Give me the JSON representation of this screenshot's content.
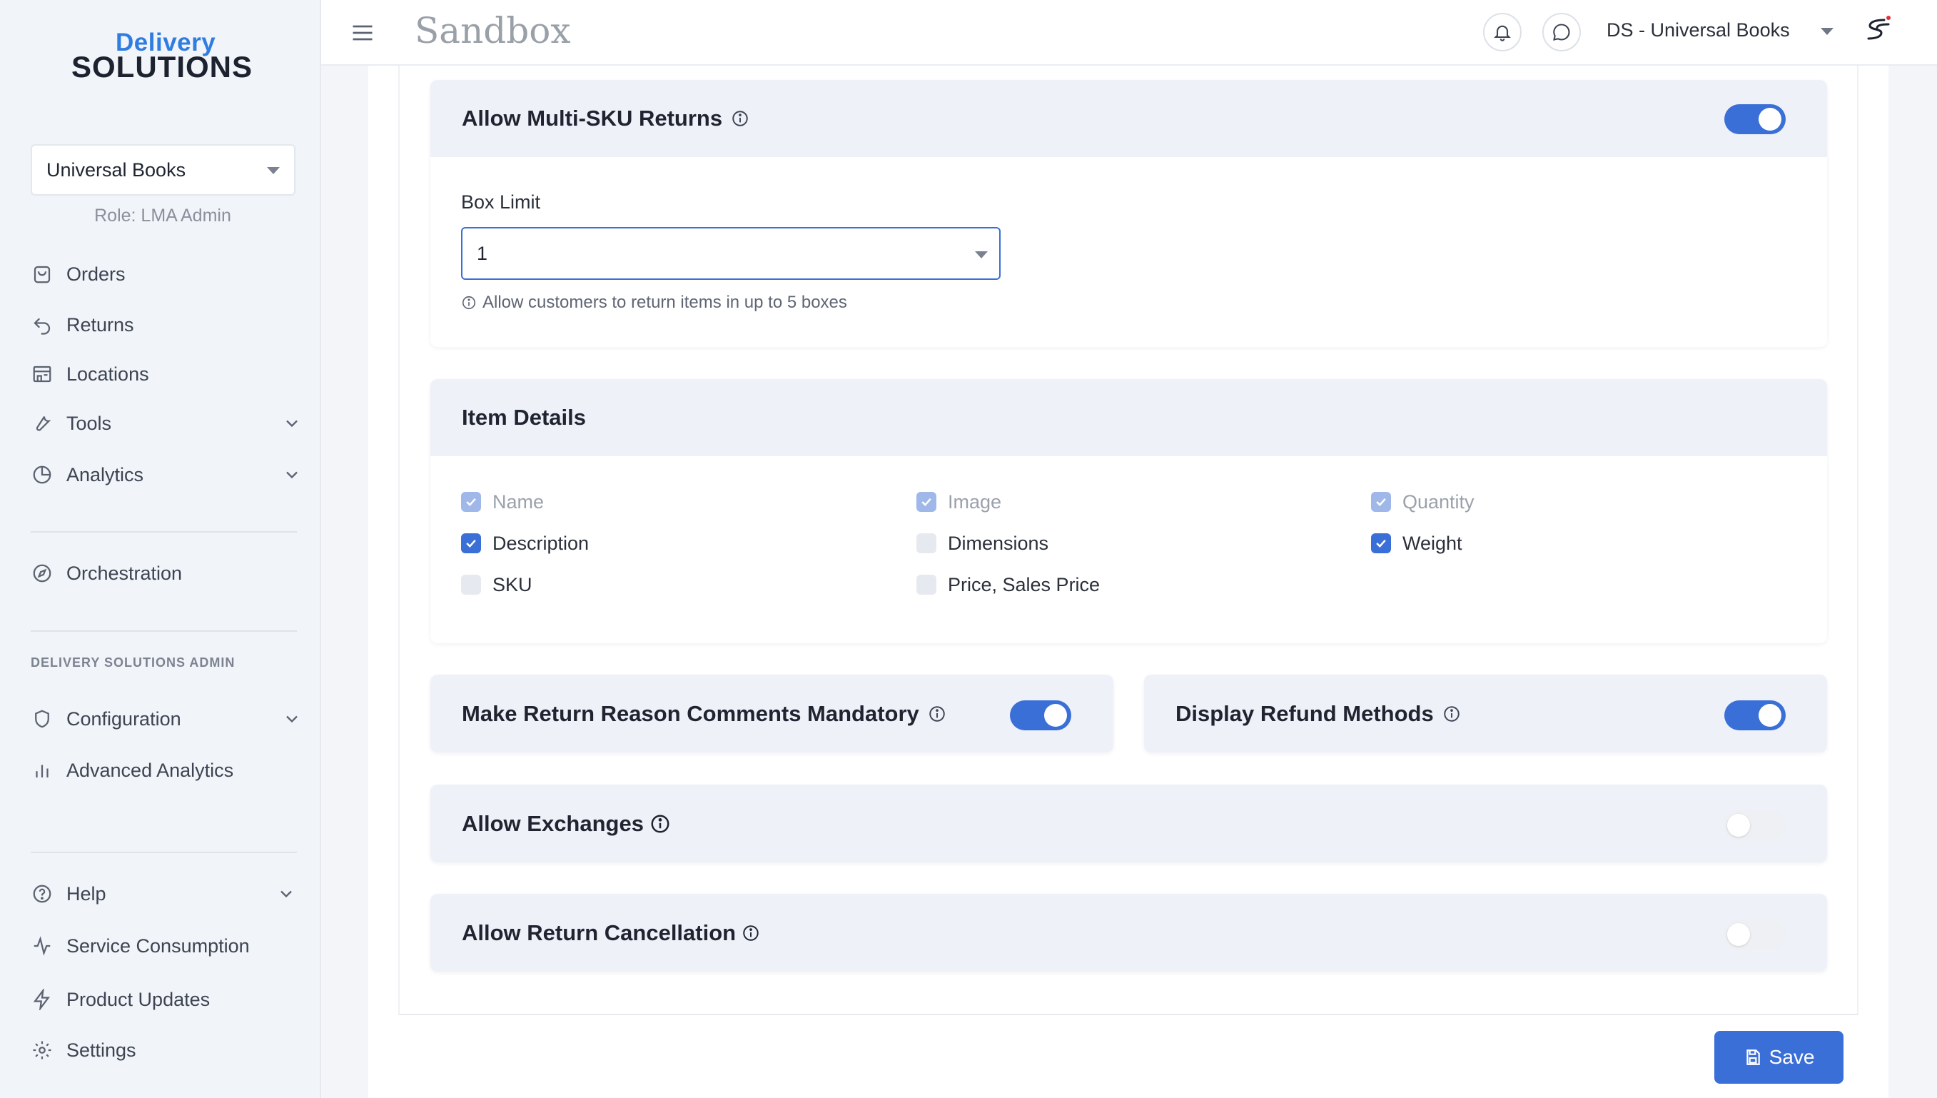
{
  "logo": {
    "top": "Delivery",
    "bottom": "SOLUTIONS"
  },
  "sidebar": {
    "org": "Universal Books",
    "role": "Role: LMA Admin",
    "items": [
      {
        "label": "Orders",
        "icon": "bag-icon"
      },
      {
        "label": "Returns",
        "icon": "return-arrow-icon"
      },
      {
        "label": "Locations",
        "icon": "store-icon"
      },
      {
        "label": "Tools",
        "icon": "wrench-icon"
      },
      {
        "label": "Analytics",
        "icon": "pie-chart-icon"
      },
      {
        "label": "Orchestration",
        "icon": "compass-icon"
      },
      {
        "label": "Configuration",
        "icon": "shield-icon"
      },
      {
        "label": "Advanced Analytics",
        "icon": "bar-chart-icon"
      },
      {
        "label": "Help",
        "icon": "help-circle-icon"
      },
      {
        "label": "Service Consumption",
        "icon": "activity-icon"
      },
      {
        "label": "Product Updates",
        "icon": "lightning-icon"
      },
      {
        "label": "Settings",
        "icon": "gear-icon"
      }
    ],
    "section_admin": "DELIVERY SOLUTIONS ADMIN"
  },
  "header": {
    "brand": "Sandbox",
    "account": "DS - Universal Books"
  },
  "multi_sku": {
    "title": "Allow Multi-SKU Returns",
    "enabled": true,
    "box_limit_label": "Box Limit",
    "box_limit_value": "1",
    "hint": "Allow customers to return items in up to 5 boxes"
  },
  "item_details": {
    "title": "Item Details",
    "fields": [
      {
        "label": "Name",
        "state": "checked-disabled"
      },
      {
        "label": "Image",
        "state": "checked-disabled"
      },
      {
        "label": "Quantity",
        "state": "checked-disabled"
      },
      {
        "label": "Description",
        "state": "checked"
      },
      {
        "label": "Dimensions",
        "state": "unchecked"
      },
      {
        "label": "Weight",
        "state": "checked"
      },
      {
        "label": "SKU",
        "state": "unchecked"
      },
      {
        "label": "Price, Sales Price",
        "state": "unchecked"
      }
    ]
  },
  "settings": {
    "comments_mandatory": {
      "title": "Make Return Reason Comments Mandatory",
      "enabled": true
    },
    "refund_methods": {
      "title": "Display Refund Methods",
      "enabled": true
    },
    "exchanges": {
      "title": "Allow Exchanges",
      "enabled": false
    },
    "cancellation": {
      "title": "Allow Return Cancellation",
      "enabled": false
    }
  },
  "footer": {
    "save_label": "Save"
  },
  "colors": {
    "accent": "#3a6fd8",
    "brand_blue": "#2f7de1"
  }
}
